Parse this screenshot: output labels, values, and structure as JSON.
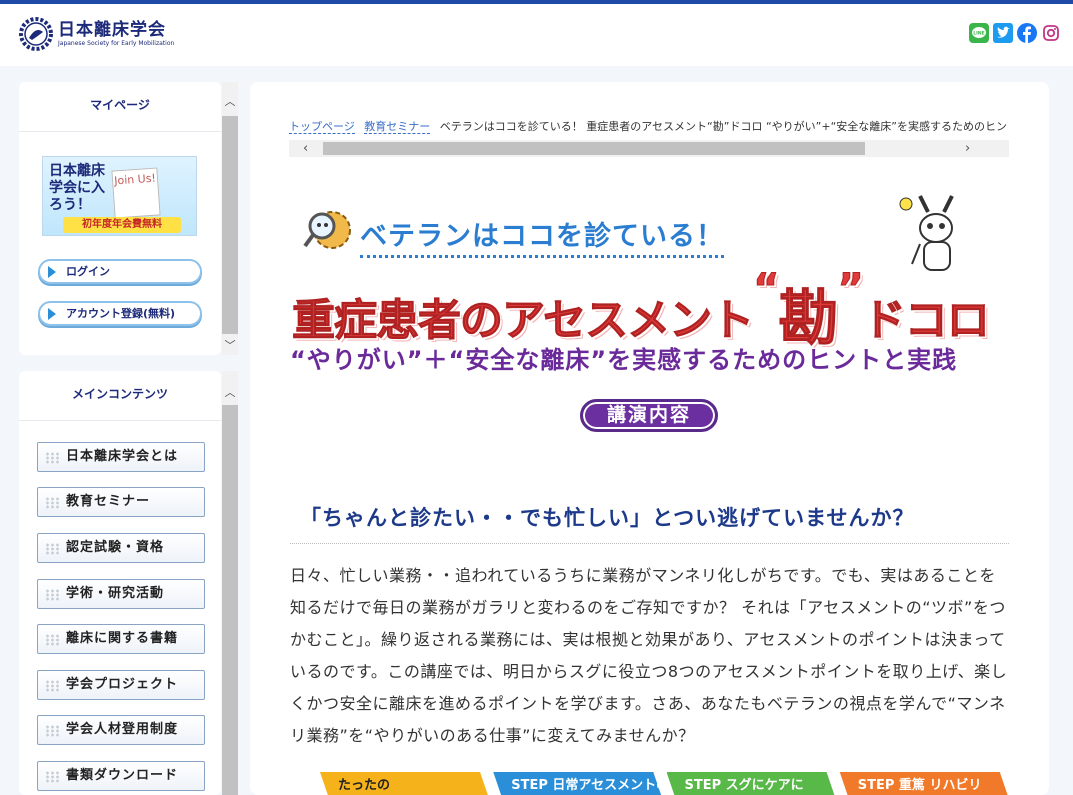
{
  "header": {
    "logo_jp": "日本離床学会",
    "logo_en": "Japanese Society for Early Mobilization"
  },
  "social": [
    "line-icon",
    "twitter-icon",
    "facebook-icon",
    "instagram-icon"
  ],
  "sidebar": {
    "mypage_title": "マイページ",
    "join_banner": {
      "text": "日本離床学会に入ろう！",
      "note": "Join Us!",
      "foot": "初年度年会費無料"
    },
    "login_label": "ログイン",
    "register_label": "アカウント登録(無料)",
    "main_title": "メインコンテンツ",
    "menu": [
      "日本離床学会とは",
      "教育セミナー",
      "認定試験・資格",
      "学術・研究活動",
      "離床に関する書籍",
      "学会プロジェクト",
      "学会人材登用制度",
      "書類ダウンロード"
    ]
  },
  "breadcrumb": {
    "home": "トップページ",
    "seminar": "教育セミナー",
    "current": "ベテランはココを診ている！ 重症患者のアセスメント“勘”ドコロ “やりがい”+“安全な離床”を実感するためのヒントと実践"
  },
  "hero": {
    "tagline": "ベテランはココを診ている！",
    "title_pre": "重症患者のアセスメント",
    "title_kan": "勘",
    "title_post": "ドコロ",
    "subtitle": "“やりがい”＋“安全な離床”を実感するためのヒントと実践",
    "lecture_button": "講演内容"
  },
  "section": {
    "heading": "「ちゃんと診たい・・でも忙しい」とつい逃げていませんか？",
    "body": "日々、忙しい業務・・追われているうちに業務がマンネリ化しがちです。でも、実はあることを知るだけで毎日の業務がガラリと変わるのをご存知ですか？ それは「アセスメントの“ツボ”をつかむこと」。繰り返される業務には、実は根拠と効果があり、アセスメントのポイントは決まっているのです。この講座では、明日からスグに役立つ8つのアセスメントポイントを取り上げ、楽しくかつ安全に離床を進めるポイントを学びます。さあ、あなたもベテランの視点を学んで“マンネリ業務”を“やりがいのある仕事”に変えてみませんか？"
  },
  "steps": [
    {
      "label": "たったの",
      "color": "#f5b21a"
    },
    {
      "label": "STEP 日常アセスメントの",
      "color": "#2a8fd8"
    },
    {
      "label": "STEP スグにケアに",
      "color": "#58b848"
    },
    {
      "label": "STEP 重篤 リハビリ",
      "color": "#f07a2a"
    }
  ]
}
